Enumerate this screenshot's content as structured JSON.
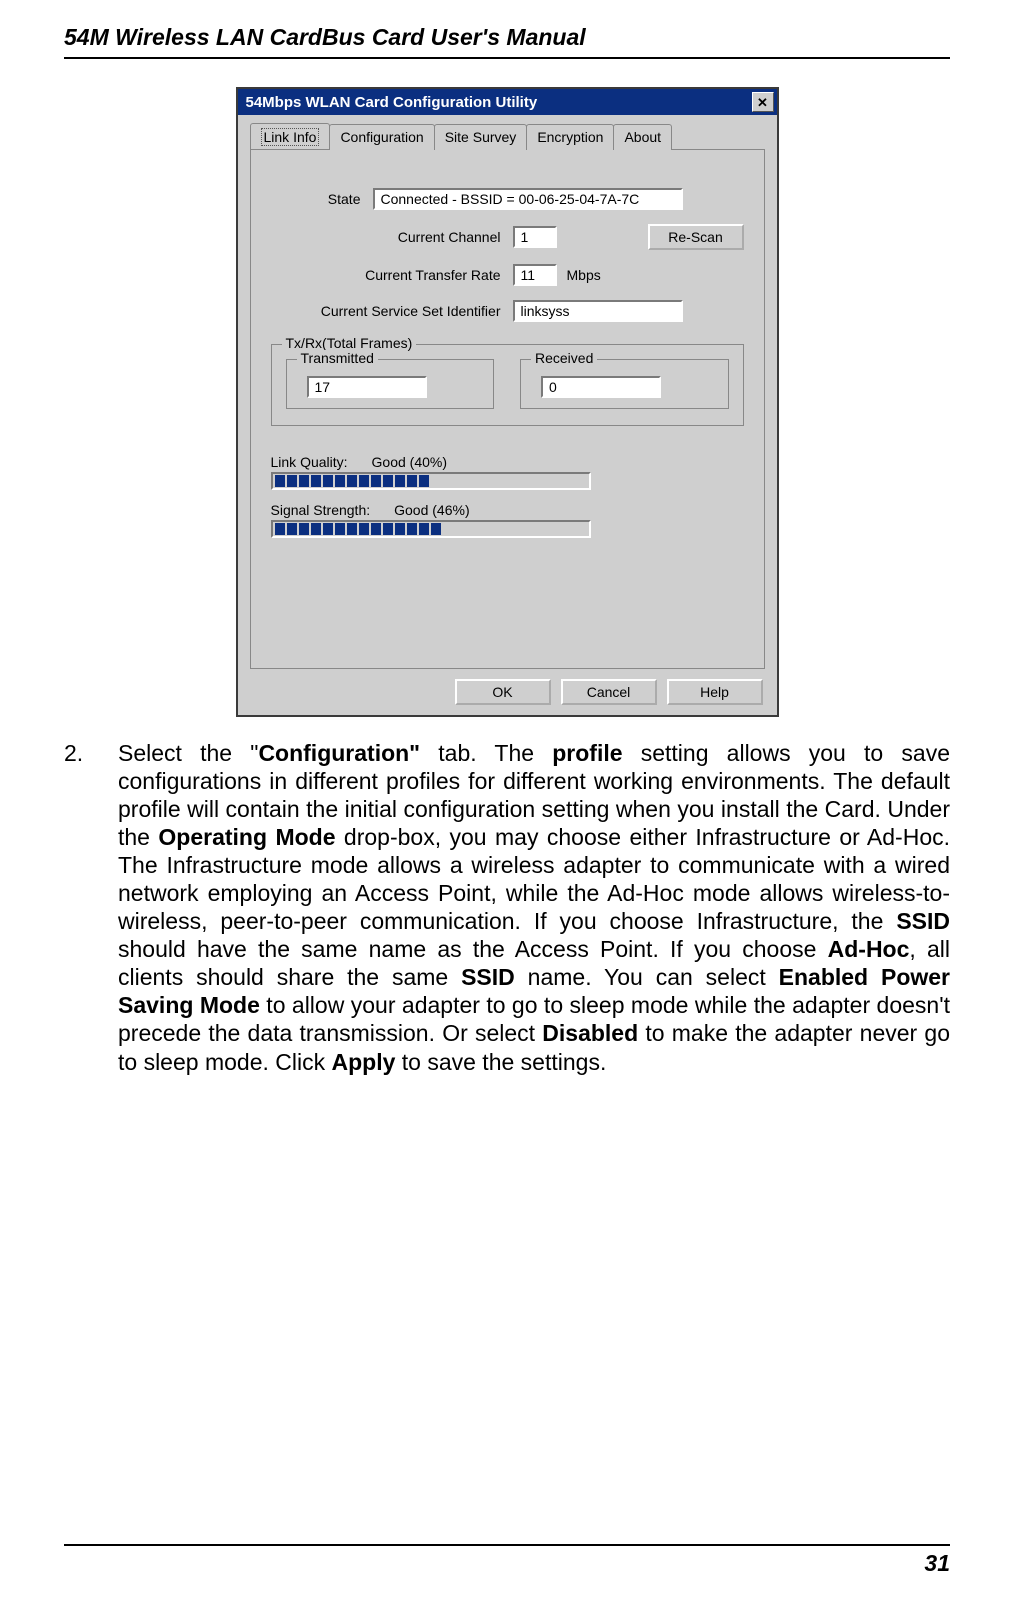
{
  "header": "54M Wireless LAN CardBus Card User's Manual",
  "page_number": "31",
  "step_number": "2.",
  "paragraph_html": "Select the \"<b>Configuration\"</b> tab. The <b>profile</b> setting allows you to save configurations in different profiles for different working environments. The default profile will contain the initial configuration setting when you install the Card. Under the <b>Operating Mode</b> drop-box, you may choose either Infrastructure or Ad-Hoc. The Infrastructure mode allows a wireless adapter to communicate with a wired network employing an Access Point, while the Ad-Hoc mode allows wireless-to-wireless, peer-to-peer communication. If you choose Infrastructure, the <b>SSID</b> should have the same name as the Access Point. If you choose <b>Ad-Hoc</b>, all clients should share the same <b>SSID</b> name. You can select <b>Enabled Power Saving Mode</b> to allow your adapter to go to sleep mode while the adapter doesn't precede the data transmission. Or select <b>Disabled</b> to make the adapter never go to sleep mode. Click <b>Apply</b> to save the settings.",
  "dialog": {
    "title": "54Mbps WLAN Card Configuration Utility",
    "tabs": [
      "Link Info",
      "Configuration",
      "Site Survey",
      "Encryption",
      "About"
    ],
    "active_tab_index": 0,
    "labels": {
      "state": "State",
      "current_channel": "Current Channel",
      "current_transfer_rate": "Current Transfer Rate",
      "mbps": "Mbps",
      "current_ssid": "Current Service Set Identifier",
      "rescan": "Re-Scan",
      "txrx_group": "Tx/Rx(Total Frames)",
      "transmitted": "Transmitted",
      "received": "Received",
      "link_quality": "Link Quality:",
      "signal_strength": "Signal Strength:",
      "ok": "OK",
      "cancel": "Cancel",
      "help": "Help"
    },
    "values": {
      "state": "Connected - BSSID = 00-06-25-04-7A-7C",
      "channel": "1",
      "rate": "11",
      "ssid": "linksyss",
      "tx": "17",
      "rx": "0",
      "link_quality": "Good (40%)",
      "signal_strength": "Good (46%)"
    }
  },
  "chart_data": [
    {
      "type": "bar",
      "title": "Link Quality",
      "categories": [
        "Link Quality"
      ],
      "values": [
        40
      ],
      "ylim": [
        0,
        100
      ],
      "segments_shown": 13,
      "segments_total_estimate": 26
    },
    {
      "type": "bar",
      "title": "Signal Strength",
      "categories": [
        "Signal Strength"
      ],
      "values": [
        46
      ],
      "ylim": [
        0,
        100
      ],
      "segments_shown": 14,
      "segments_total_estimate": 26
    }
  ]
}
